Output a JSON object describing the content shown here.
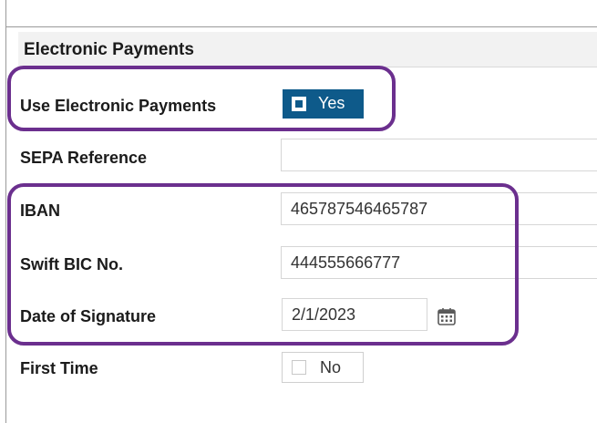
{
  "section": {
    "title": "Electronic Payments"
  },
  "rows": {
    "use_electronic_payments": {
      "label": "Use Electronic Payments",
      "value": "Yes",
      "checked": true
    },
    "sepa_reference": {
      "label": "SEPA Reference",
      "value": ""
    },
    "iban": {
      "label": "IBAN",
      "value": "465787546465787"
    },
    "swift_bic": {
      "label": "Swift BIC No.",
      "value": "444555666777"
    },
    "date_of_signature": {
      "label": "Date of Signature",
      "value": "2/1/2023"
    },
    "first_time": {
      "label": "First Time",
      "value": "No",
      "checked": false
    }
  },
  "colors": {
    "toggle_on": "#0e5a8a",
    "highlight": "#6b2f8e",
    "header_bg": "#f2f2f2"
  },
  "icons": {
    "date_picker": "calendar-icon"
  }
}
